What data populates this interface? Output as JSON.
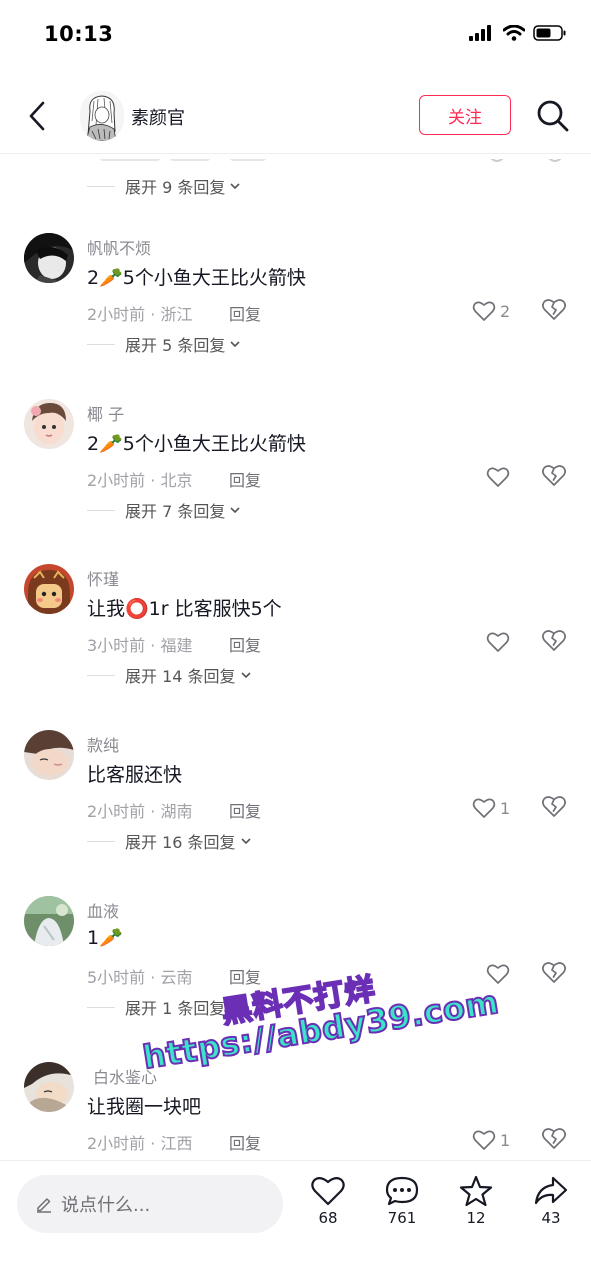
{
  "status_bar": {
    "time": "10:13"
  },
  "header": {
    "title": "素颜官",
    "follow_label": "关注"
  },
  "expand_top": {
    "label": "展开 9 条回复"
  },
  "comments": [
    {
      "name": "帆帆不烦",
      "text": "2🥕5个小鱼大王比火箭快",
      "meta": "2小时前 · 浙江",
      "reply": "回复",
      "likes": "2",
      "expand": "展开 5 条回复"
    },
    {
      "name": "椰 子",
      "text": "2🥕5个小鱼大王比火箭快",
      "meta": "2小时前 · 北京",
      "reply": "回复",
      "likes": "",
      "expand": "展开 7 条回复"
    },
    {
      "name": "怀瑾",
      "text": "让我⭕1r  比客服快5个",
      "meta": "3小时前 · 福建",
      "reply": "回复",
      "likes": "",
      "expand": "展开 14 条回复"
    },
    {
      "name": "款纯",
      "text": "比客服还快",
      "meta": "2小时前 · 湖南",
      "reply": "回复",
      "likes": "1",
      "expand": "展开 16 条回复"
    },
    {
      "name": "血液",
      "text": "1🥕",
      "meta": "5小时前 · 云南",
      "reply": "回复",
      "likes": "",
      "expand": "展开 1 条回复"
    },
    {
      "name": "白水鉴心",
      "text": "让我圈一块吧",
      "meta": "2小时前 · 江西",
      "reply": "回复",
      "likes": "1",
      "expand": ""
    }
  ],
  "watermark": {
    "line1": "黑料不打烊",
    "line2": "https://abdy39.com"
  },
  "bottom_bar": {
    "input_placeholder": "说点什么...",
    "likes": "68",
    "comments": "761",
    "favorites": "12",
    "shares": "43"
  },
  "colors": {
    "accent": "#fe2c55",
    "watermark_fill": "#3be3c9",
    "watermark_stroke": "#6b2fb5"
  },
  "icons": [
    "back-arrow-icon",
    "search-icon",
    "heart-icon",
    "broken-heart-icon",
    "chevron-down-icon",
    "pencil-icon",
    "comment-icon",
    "star-icon",
    "share-icon",
    "signal-icon",
    "wifi-icon",
    "battery-icon"
  ]
}
